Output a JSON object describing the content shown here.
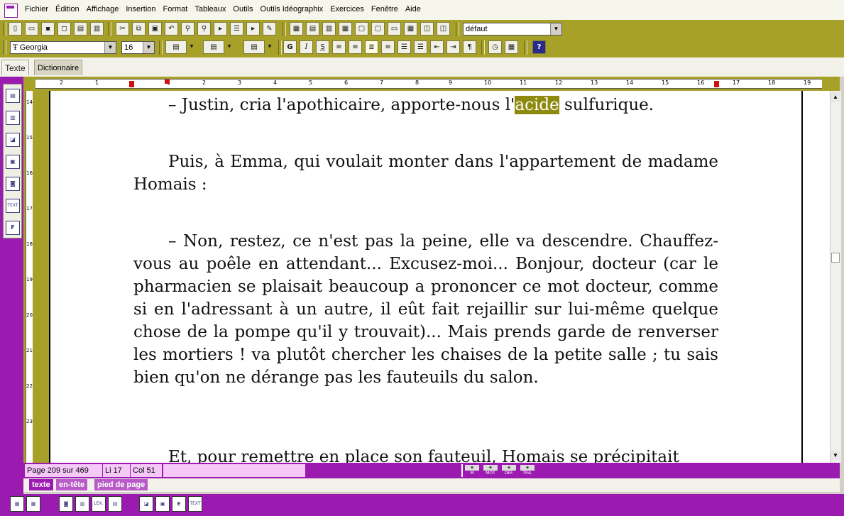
{
  "menu": {
    "items": [
      "Fichier",
      "Édition",
      "Affichage",
      "Insertion",
      "Format",
      "Tableaux",
      "Outils",
      "Outils Idéographix",
      "Exercices",
      "Fenêtre",
      "Aide"
    ]
  },
  "toolbar1": {
    "style_value": "défaut"
  },
  "toolbar2": {
    "font_value": "Georgia",
    "size_value": "16",
    "bold_label": "G",
    "italic_label": "I",
    "underline_label": "S",
    "pilcrow": "¶",
    "help_label": "?"
  },
  "tabs": {
    "texte": "Texte",
    "dictionnaire": "Dictionnaire"
  },
  "ruler": {
    "h_numbers": [
      "2",
      "1",
      "1",
      "2",
      "3",
      "4",
      "5",
      "6",
      "7",
      "8",
      "9",
      "10",
      "11",
      "12",
      "13",
      "14",
      "15",
      "16",
      "17",
      "18",
      "19"
    ],
    "v_numbers": [
      "14",
      "15",
      "16",
      "17",
      "18",
      "19",
      "20",
      "21",
      "22",
      "23"
    ]
  },
  "document": {
    "para1_before": "– Justin, cria l'apothicaire, apporte-nous l'",
    "para1_highlight": "acide",
    "para1_after": " sulfurique.",
    "para2": "Puis, à Emma, qui voulait monter dans l'appartement de madame Homais :",
    "para3": "– Non, restez, ce n'est pas la peine, elle va descendre. Chauffez-vous au poêle en attendant... Excusez-moi... Bonjour, docteur (car le pharmacien se plaisait beaucoup a prononcer ce mot docteur, comme si en l'adressant à un autre, il eût fait rejaillir sur lui-même quelque chose de la pompe qu'il y trouvait)... Mais prends garde de renverser les mortiers ! va plutôt chercher les chaises de la petite salle ; tu sais bien qu'on ne dérange pas les fauteuils du salon.",
    "para4": "Et, pour remettre en place son fauteuil, Homais se précipitait"
  },
  "status": {
    "page": "Page 209 sur 469",
    "line": "Li 17",
    "col": "Col 51",
    "icons": [
      "M",
      "MOT",
      "DÉF.",
      "TRA."
    ]
  },
  "footer_tabs": [
    "texte",
    "en-tête",
    "pied de page"
  ],
  "bottom_buttons": [
    "",
    "",
    "",
    "",
    "LEX.",
    "",
    "",
    "",
    "E",
    "TEXT"
  ],
  "colors": {
    "olive": "#a7a12a",
    "purple": "#9b1ab0",
    "highlight": "#8d8a0e"
  }
}
